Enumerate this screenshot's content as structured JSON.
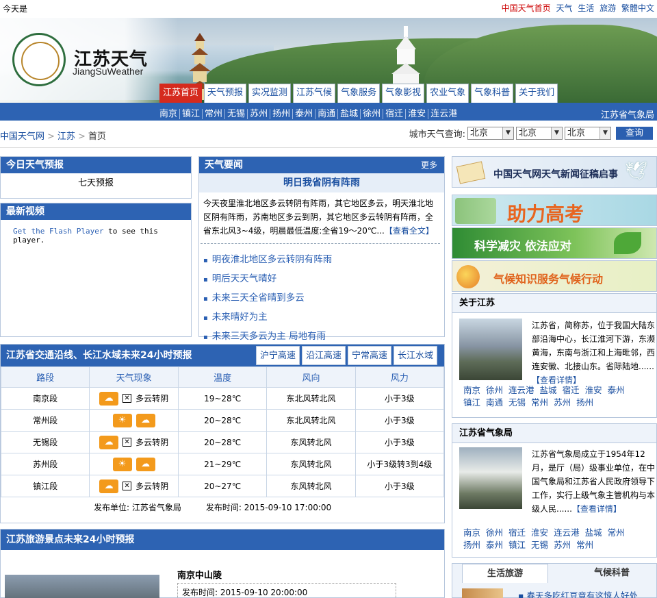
{
  "top": {
    "today": "今天是",
    "links": [
      "中国天气首页",
      "天气",
      "生活",
      "旅游",
      "繁體中文"
    ]
  },
  "logo": {
    "title": "江苏天气",
    "subtitle": "JiangSuWeather"
  },
  "main_tabs": [
    "江苏首页",
    "天气预报",
    "实况监测",
    "江苏气候",
    "气象服务",
    "气象影视",
    "农业气象",
    "气象科普",
    "关于我们"
  ],
  "cities": [
    "南京",
    "镇江",
    "常州",
    "无锡",
    "苏州",
    "扬州",
    "泰州",
    "南通",
    "盐城",
    "徐州",
    "宿迁",
    "淮安",
    "连云港"
  ],
  "bureau": "江苏省气象局",
  "breadcrumb": {
    "home": "中国天气网",
    "region": "江苏",
    "page": "首页"
  },
  "city_query": {
    "label": "城市天气查询:",
    "sel1": "北京",
    "sel2": "北京",
    "sel3": "北京",
    "button": "查询"
  },
  "today_forecast": {
    "title": "今日天气预报",
    "seven_day": "七天预报"
  },
  "video": {
    "title": "最新视频",
    "flash_link": "Get the Flash Player",
    "flash_text": " to see this player."
  },
  "news": {
    "title": "天气要闻",
    "more": "更多",
    "headline": "明日我省阴有阵雨",
    "summary": "今天夜里淮北地区多云转阴有阵雨，其它地区多云，明天淮北地区阴有阵雨，苏南地区多云到阴，其它地区多云转阴有阵雨，全省东北风3~4级，明晨最低温度:全省19～20℃...",
    "read_more": "【查看全文】",
    "items": [
      "明夜淮北地区多云转阴有阵雨",
      "明后天天气晴好",
      "未来三天全省晴到多云",
      "未来晴好为主",
      "未来三天多云为主 局地有雨"
    ]
  },
  "ads": [
    "中国天气网天气新闻征稿启事",
    "助力高考",
    "科学减灾 依法应对",
    "气候知识服务气候行动"
  ],
  "traffic": {
    "title": "江苏省交通沿线、长江水域未来24小时预报",
    "tabs": [
      "沪宁高速",
      "沿江高速",
      "宁常高速",
      "长江水域"
    ],
    "headers": [
      "路段",
      "天气现象",
      "温度",
      "风向",
      "风力"
    ],
    "rows": [
      {
        "name": "南京段",
        "wx": "多云转阴",
        "temp": "19~28℃",
        "dir": "东北风转北风",
        "force": "小于3级"
      },
      {
        "name": "常州段",
        "wx": "",
        "temp": "20~28℃",
        "dir": "东北风转北风",
        "force": "小于3级"
      },
      {
        "name": "无锡段",
        "wx": "多云转阴",
        "temp": "20~28℃",
        "dir": "东风转北风",
        "force": "小于3级"
      },
      {
        "name": "苏州段",
        "wx": "",
        "temp": "21~29℃",
        "dir": "东风转北风",
        "force": "小于3级转3到4级"
      },
      {
        "name": "镇江段",
        "wx": "多云转阴",
        "temp": "20~27℃",
        "dir": "东风转北风",
        "force": "小于3级"
      }
    ],
    "publisher": "发布单位: 江苏省气象局",
    "pubtime": "发布时间: 2015-09-10 17:00:00"
  },
  "tourist": {
    "title": "江苏旅游景点未来24小时预报",
    "spot": "南京中山陵",
    "time": "发布时间: 2015-09-10 20:00:00"
  },
  "about": {
    "title": "关于江苏",
    "text": "江苏省，简称苏，位于我国大陆东部沿海中心，长江淮河下游，东濒黄海，东南与浙江和上海毗邻，西连安徽、北接山东。省际陆地......",
    "link": "【查看详情】",
    "cities": [
      "南京",
      "徐州",
      "连云港",
      "盐城",
      "宿迁",
      "淮安",
      "泰州",
      "镇江",
      "南通",
      "无锡",
      "常州",
      "苏州",
      "扬州"
    ]
  },
  "bureau_info": {
    "title": "江苏省气象局",
    "text": "江苏省气象局成立于1954年12月，是厅（局）级事业单位，在中国气象局和江苏省人民政府领导下工作，实行上级气象主管机构与本级人民......",
    "link": "【查看详情】",
    "cities": [
      "南京",
      "徐州",
      "宿迁",
      "淮安",
      "连云港",
      "盐城",
      "常州",
      "扬州",
      "泰州",
      "镇江",
      "无锡",
      "苏州",
      "常州"
    ]
  },
  "life_tabs": [
    "生活旅游",
    "气候科普"
  ],
  "life_item": "春天多吃红豆竟有这惊人好处"
}
